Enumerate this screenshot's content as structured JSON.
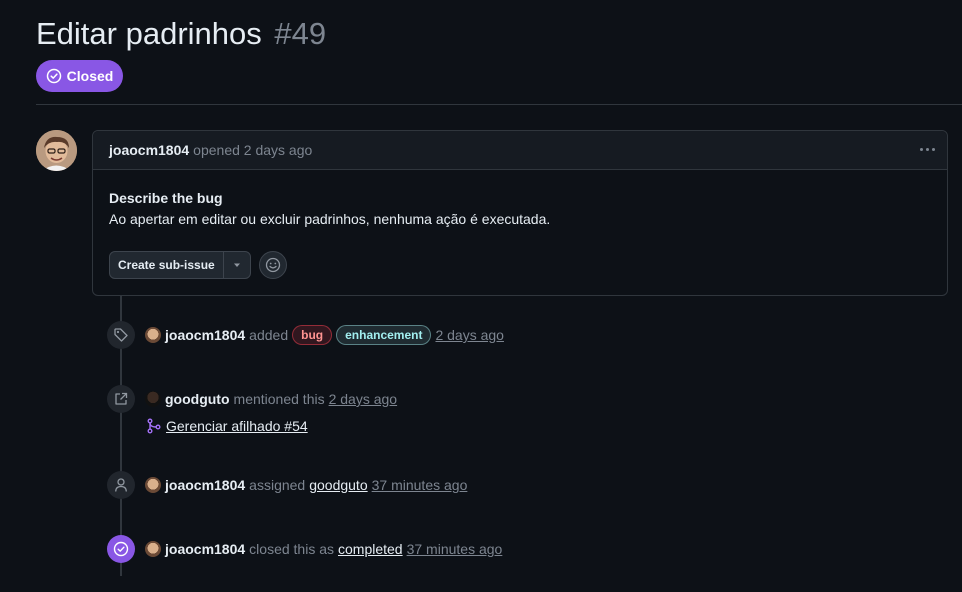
{
  "issue": {
    "title": "Editar padrinhos",
    "number": "#49",
    "state_label": "Closed",
    "state_color": "#8957e5"
  },
  "comment": {
    "author": "joaocm1804",
    "meta": "opened 2 days ago",
    "heading": "Describe the bug",
    "body": "Ao apertar em editar ou excluir padrinhos, nenhuma ação é executada.",
    "sub_issue_button": "Create sub-issue"
  },
  "timeline": {
    "labeled": {
      "author": "joaocm1804",
      "action": "added",
      "labels": [
        {
          "name": "bug",
          "color": "#d73a4a"
        },
        {
          "name": "enhancement",
          "color": "#a2eeef"
        }
      ],
      "time": "2 days ago"
    },
    "mentioned": {
      "author": "goodguto",
      "action": "mentioned this",
      "time": "2 days ago",
      "reference": "Gerenciar afilhado #54"
    },
    "assigned": {
      "author": "joaocm1804",
      "action": "assigned",
      "assignee": "goodguto",
      "time": "37 minutes ago"
    },
    "closed": {
      "author": "joaocm1804",
      "action": "closed this as",
      "reason": "completed",
      "time": "37 minutes ago"
    }
  }
}
